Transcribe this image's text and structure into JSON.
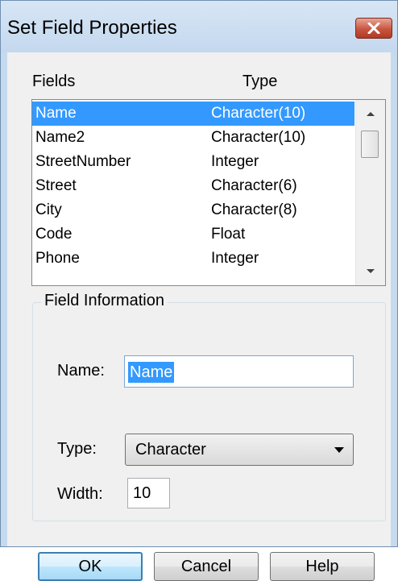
{
  "window": {
    "title": "Set Field Properties",
    "close_glyph": "✕"
  },
  "list": {
    "headers": {
      "fields": "Fields",
      "type": "Type"
    },
    "rows": [
      {
        "name": "Name",
        "type": "Character(10)",
        "selected": true
      },
      {
        "name": "Name2",
        "type": "Character(10)",
        "selected": false
      },
      {
        "name": "StreetNumber",
        "type": "Integer",
        "selected": false
      },
      {
        "name": "Street",
        "type": "Character(6)",
        "selected": false
      },
      {
        "name": "City",
        "type": "Character(8)",
        "selected": false
      },
      {
        "name": "Code",
        "type": "Float",
        "selected": false
      },
      {
        "name": "Phone",
        "type": "Integer",
        "selected": false
      }
    ],
    "scroll_up_glyph": "▲",
    "scroll_down_glyph": "▼"
  },
  "field_info": {
    "legend": "Field Information",
    "name_label": "Name:",
    "name_value": "Name",
    "type_label": "Type:",
    "type_value": "Character",
    "type_arrow_glyph": "▼",
    "width_label": "Width:",
    "width_value": "10"
  },
  "buttons": {
    "ok": "OK",
    "cancel": "Cancel",
    "help": "Help"
  },
  "colors": {
    "selection": "#3399ff",
    "client_bg": "#f0f0f0",
    "title_bg": "#c5daef"
  }
}
